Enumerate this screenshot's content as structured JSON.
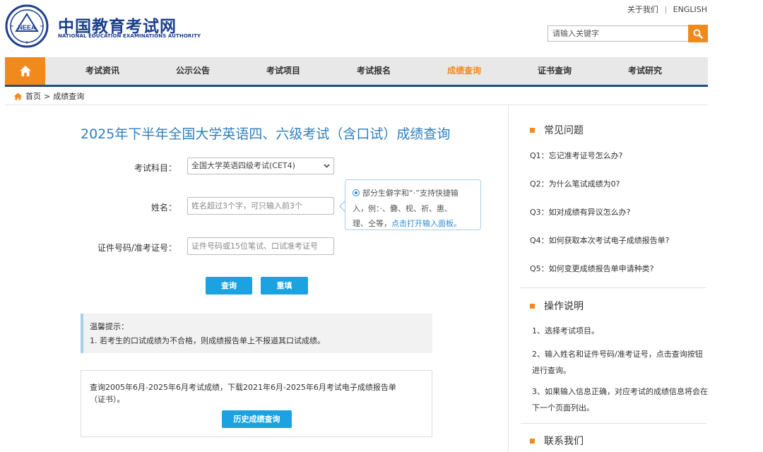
{
  "header": {
    "logo_cn": "中国教育考试网",
    "logo_en": "NATIONAL EDUCATION EXAMINATIONS AUTHORITY",
    "logo_emblem_text": "NEEA",
    "top_links": {
      "about": "关于我们",
      "separator": "|",
      "english": "ENGLISH"
    },
    "search": {
      "placeholder": "请输入关键字",
      "icon": "search-icon"
    }
  },
  "nav": {
    "home_icon": "home-icon",
    "items": [
      {
        "label": "考试资讯"
      },
      {
        "label": "公示公告"
      },
      {
        "label": "考试项目"
      },
      {
        "label": "考试报名"
      },
      {
        "label": "成绩查询"
      },
      {
        "label": "证书查询"
      },
      {
        "label": "考试研究"
      }
    ],
    "active_index": 4
  },
  "breadcrumb": {
    "home": "首页",
    "separator": ">",
    "current": "成绩查询"
  },
  "main": {
    "title": "2025年下半年全国大学英语四、六级考试（含口试）成绩查询",
    "form": {
      "subject_label": "考试科目：",
      "subject_value": "全国大学英语四级考试(CET4)",
      "name_label": "姓名：",
      "name_placeholder": "姓名超过3个字，可只输入前3个",
      "id_label": "证件号码/准考证号：",
      "id_placeholder": "证件号码或15位笔试、口试准考证号",
      "query_button": "查询",
      "reset_button": "重填"
    },
    "tip": {
      "line1": "部分生僻字和“·”支持快捷输",
      "line2": "入，例：·、爨、枧、祈、惠、",
      "line3_prefix": "理、仝等，",
      "line3_link": "点击打开输入面板。"
    },
    "notice": {
      "title": "温馨提示：",
      "item1": "1. 若考生的口试成绩为不合格，则成绩报告单上不报道其口试成绩。"
    },
    "history": {
      "text_line1": "查询2005年6月-2025年6月考试成绩，下载2021年6月-2025年6月考试电子成绩报告单",
      "text_line2": "（证书）。",
      "button": "历史成绩查询"
    }
  },
  "sidebar": {
    "faq_title": "常见问题",
    "faqs": [
      "Q1：忘记准考证号怎么办?",
      "Q2：为什么笔试成绩为0?",
      "Q3：如对成绩有异议怎么办?",
      "Q4：如何获取本次考试电子成绩报告单?",
      "Q5：如何变更成绩报告单申请种类?"
    ],
    "ops_title": "操作说明",
    "ops": [
      "1、选择考试项目。",
      "2、输入姓名和证件号码/准考证号，点击查询按钮进行查询。",
      "3、如果输入信息正确，对应考试的成绩信息将会在下一个页面列出。"
    ],
    "contact_title": "联系我们"
  },
  "colors": {
    "accent_orange": "#f08a1c",
    "nav_blue": "#1f4e8c",
    "title_blue": "#2e7fbf",
    "button_blue": "#1aa3e0"
  }
}
